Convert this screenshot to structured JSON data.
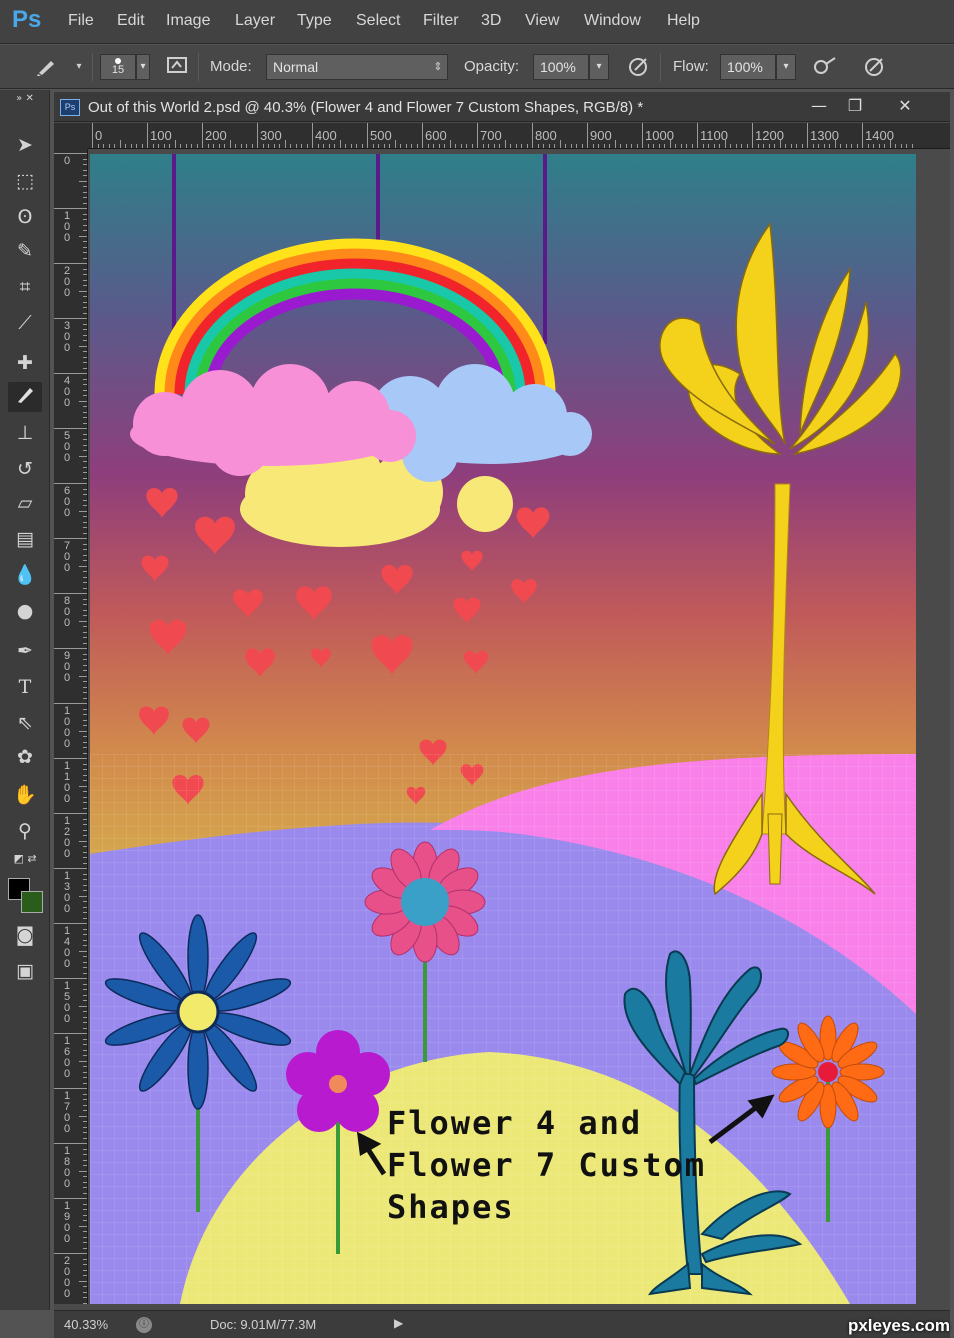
{
  "app": {
    "logo": "Ps"
  },
  "menu": [
    "File",
    "Edit",
    "Image",
    "Layer",
    "Type",
    "Select",
    "Filter",
    "3D",
    "View",
    "Window",
    "Help"
  ],
  "options_bar": {
    "brush_size": "15",
    "mode_label": "Mode:",
    "mode_value": "Normal",
    "opacity_label": "Opacity:",
    "opacity_value": "100%",
    "flow_label": "Flow:",
    "flow_value": "100%"
  },
  "tools": [
    "move-icon",
    "marquee-icon",
    "lasso-icon",
    "quick-select-icon",
    "crop-icon",
    "eyedropper-icon",
    "healing-brush-icon",
    "brush-icon",
    "clone-stamp-icon",
    "history-brush-icon",
    "eraser-icon",
    "gradient-icon",
    "blur-icon",
    "dodge-icon",
    "pen-icon",
    "type-icon",
    "path-select-icon",
    "custom-shape-icon",
    "hand-icon",
    "zoom-icon"
  ],
  "active_tool": "brush-icon",
  "colors": {
    "foreground": "#000000",
    "background": "#2a5c1c"
  },
  "document": {
    "title": "Out of this World 2.psd @ 40.3% (Flower 4 and Flower 7 Custom Shapes, RGB/8) *",
    "ps_badge": "Ps",
    "minimize": "—",
    "restore": "❐",
    "close": "✕"
  },
  "ruler_h": [
    "0",
    "100",
    "200",
    "300",
    "400",
    "500",
    "600",
    "700",
    "800",
    "900",
    "1000",
    "1100",
    "1200",
    "1300",
    "1400"
  ],
  "ruler_v": [
    "0",
    "100",
    "200",
    "300",
    "400",
    "500",
    "600",
    "700",
    "800",
    "900",
    "1000",
    "1100",
    "1200",
    "1300",
    "1400",
    "1500",
    "1600",
    "1700",
    "1800",
    "1900",
    "2000"
  ],
  "artwork": {
    "caption_line1": "Flower 4 and",
    "caption_line2": "Flower 7 Custom",
    "caption_line3": "Shapes"
  },
  "status": {
    "zoom": "40.33%",
    "doc_size": "Doc: 9.01M/77.3M"
  },
  "watermark": "pxleyes.com"
}
